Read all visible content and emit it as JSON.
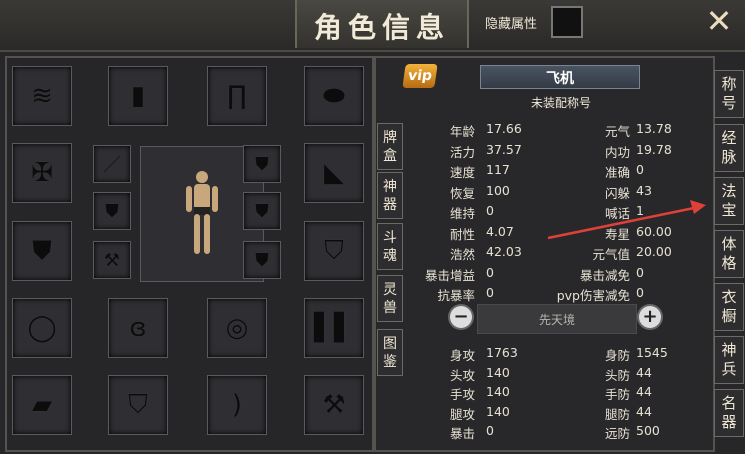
{
  "header": {
    "title": "角色信息",
    "hide_attr_label": "隐藏属性",
    "close_icon": "close-x-icon"
  },
  "character": {
    "name": "飞机",
    "vip_badge": "vip",
    "title_status": "未装配称号"
  },
  "left_tabs": [
    "牌盒",
    "神器",
    "斗魂",
    "灵兽",
    "图鉴"
  ],
  "right_tabs": [
    "称号",
    "经脉",
    "法宝",
    "体格",
    "衣橱",
    "神兵",
    "名器"
  ],
  "stats_top": [
    {
      "l1": "年龄",
      "v1": "17.66",
      "l2": "元气",
      "v2": "13.78"
    },
    {
      "l1": "活力",
      "v1": "37.57",
      "l2": "内功",
      "v2": "19.78"
    },
    {
      "l1": "速度",
      "v1": "117",
      "l2": "准确",
      "v2": "0"
    },
    {
      "l1": "恢复",
      "v1": "100",
      "l2": "闪躲",
      "v2": "43"
    },
    {
      "l1": "维持",
      "v1": "0",
      "l2": "喊话",
      "v2": "1"
    },
    {
      "l1": "耐性",
      "v1": "4.07",
      "l2": "寿星",
      "v2": "60.00"
    },
    {
      "l1": "浩然",
      "v1": "42.03",
      "l2": "元气值",
      "v2": "20.00"
    },
    {
      "l1": "暴击增益",
      "v1": "0",
      "l2": "暴击减免",
      "v2": "0"
    },
    {
      "l1": "抗暴率",
      "v1": "0",
      "l2": "pvp伤害减免",
      "v2": "0"
    }
  ],
  "realm": {
    "label": "先天境",
    "minus": "−",
    "plus": "+"
  },
  "stats_bottom": [
    {
      "l1": "身攻",
      "v1": "1763",
      "l2": "身防",
      "v2": "1545"
    },
    {
      "l1": "头攻",
      "v1": "140",
      "l2": "头防",
      "v2": "44"
    },
    {
      "l1": "手攻",
      "v1": "140",
      "l2": "手防",
      "v2": "44"
    },
    {
      "l1": "腿攻",
      "v1": "140",
      "l2": "腿防",
      "v2": "44"
    },
    {
      "l1": "暴击",
      "v1": "0",
      "l2": "远防",
      "v2": "500"
    }
  ],
  "accent": {
    "arrow": "#e0403a",
    "vip": "#f3b23a",
    "name_plate": "#4a5462"
  }
}
